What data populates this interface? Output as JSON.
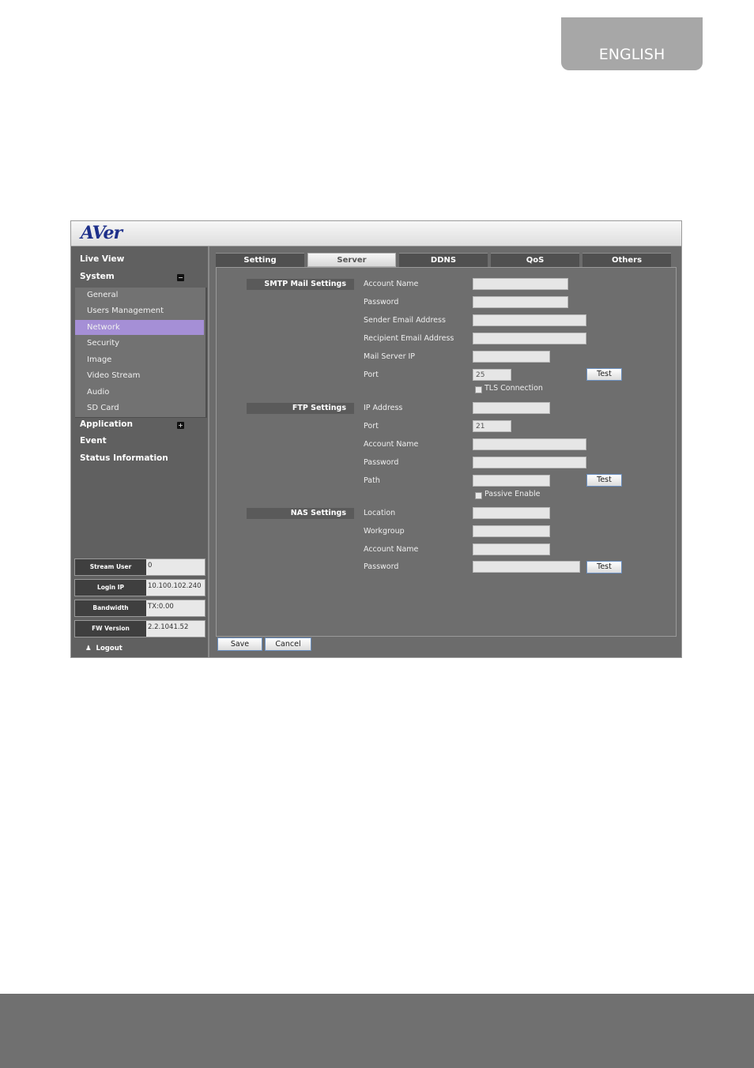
{
  "page": {
    "language_tab": "ENGLISH"
  },
  "app": {
    "logo": "AVer",
    "sidebar": {
      "live_view": "Live View",
      "system": "System",
      "system_toggle": "−",
      "system_items": [
        "General",
        "Users Management",
        "Network",
        "Security",
        "Image",
        "Video Stream",
        "Audio",
        "SD Card"
      ],
      "active_item": "Network",
      "application": "Application",
      "application_toggle": "+",
      "event": "Event",
      "status_information": "Status Information",
      "info": [
        {
          "label": "Stream User",
          "value": "0"
        },
        {
          "label": "Login IP",
          "value": "10.100.102.240"
        },
        {
          "label": "Bandwidth",
          "value": "TX:0.00"
        },
        {
          "label": "FW Version",
          "value": "2.2.1041.52"
        }
      ],
      "logout": "Logout"
    },
    "tabs": [
      "Setting",
      "Server",
      "DDNS",
      "QoS",
      "Others"
    ],
    "active_tab": "Server",
    "smtp": {
      "title": "SMTP Mail Settings",
      "account_name": "Account Name",
      "password": "Password",
      "sender_email": "Sender Email Address",
      "recipient_email": "Recipient Email Address",
      "mail_server_ip": "Mail Server IP",
      "port": "Port",
      "port_value": "25",
      "test": "Test",
      "tls": "TLS Connection"
    },
    "ftp": {
      "title": "FTP Settings",
      "ip_address": "IP Address",
      "port": "Port",
      "port_value": "21",
      "account_name": "Account Name",
      "password": "Password",
      "path": "Path",
      "test": "Test",
      "passive": "Passive Enable"
    },
    "nas": {
      "title": "NAS Settings",
      "location": "Location",
      "workgroup": "Workgroup",
      "account_name": "Account Name",
      "password": "Password",
      "test": "Test"
    },
    "save": "Save",
    "cancel": "Cancel"
  }
}
